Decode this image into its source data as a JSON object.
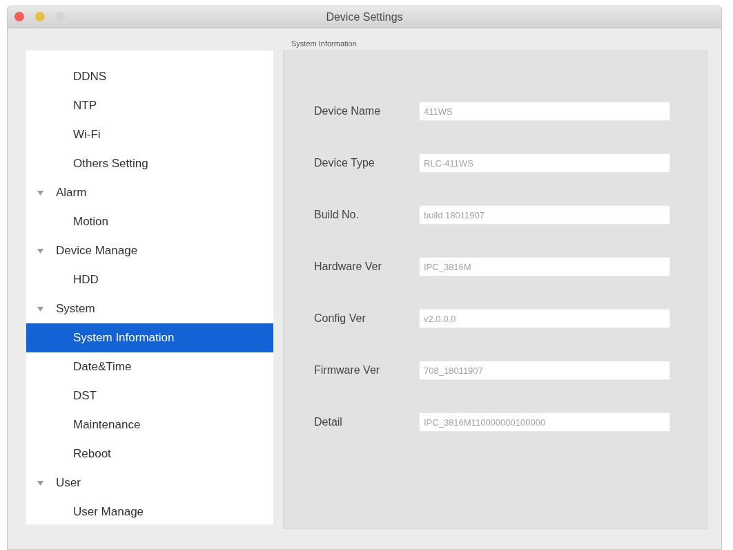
{
  "window": {
    "title": "Device Settings",
    "controls": [
      {
        "kind": "close",
        "disabled": false
      },
      {
        "kind": "minimize",
        "disabled": false
      },
      {
        "kind": "zoom",
        "disabled": true
      }
    ]
  },
  "sidebar": {
    "tree": [
      {
        "children": [
          {
            "label": "DDNS",
            "selected": false
          },
          {
            "label": "NTP",
            "selected": false
          },
          {
            "label": "Wi-Fi",
            "selected": false
          },
          {
            "label": "Others Setting",
            "selected": false
          }
        ]
      },
      {
        "label": "Alarm",
        "expanded": true,
        "selected": false,
        "children": [
          {
            "label": "Motion",
            "selected": false
          }
        ]
      },
      {
        "label": "Device Manage",
        "expanded": true,
        "selected": false,
        "children": [
          {
            "label": "HDD",
            "selected": false
          }
        ]
      },
      {
        "label": "System",
        "expanded": true,
        "selected": false,
        "children": [
          {
            "label": "System Information",
            "selected": true
          },
          {
            "label": "Date&Time",
            "selected": false
          },
          {
            "label": "DST",
            "selected": false
          },
          {
            "label": "Maintenance",
            "selected": false
          },
          {
            "label": "Reboot",
            "selected": false
          }
        ]
      },
      {
        "label": "User",
        "expanded": true,
        "selected": false,
        "children": [
          {
            "label": "User Manage",
            "selected": false
          }
        ]
      }
    ]
  },
  "panel": {
    "title": "System Information",
    "fields": [
      {
        "label": "Device Name",
        "value": "411WS",
        "disabled": true
      },
      {
        "label": "Device Type",
        "value": "RLC-411WS",
        "disabled": true
      },
      {
        "label": "Build No.",
        "value": "build 18011907",
        "disabled": true
      },
      {
        "label": "Hardware Ver",
        "value": "IPC_3816M",
        "disabled": true
      },
      {
        "label": "Config Ver",
        "value": "v2.0.0.0",
        "disabled": true
      },
      {
        "label": "Firmware Ver",
        "value": "708_18011907",
        "disabled": true
      },
      {
        "label": "Detail",
        "value": "IPC_3816M110000000100000",
        "disabled": true
      }
    ]
  }
}
